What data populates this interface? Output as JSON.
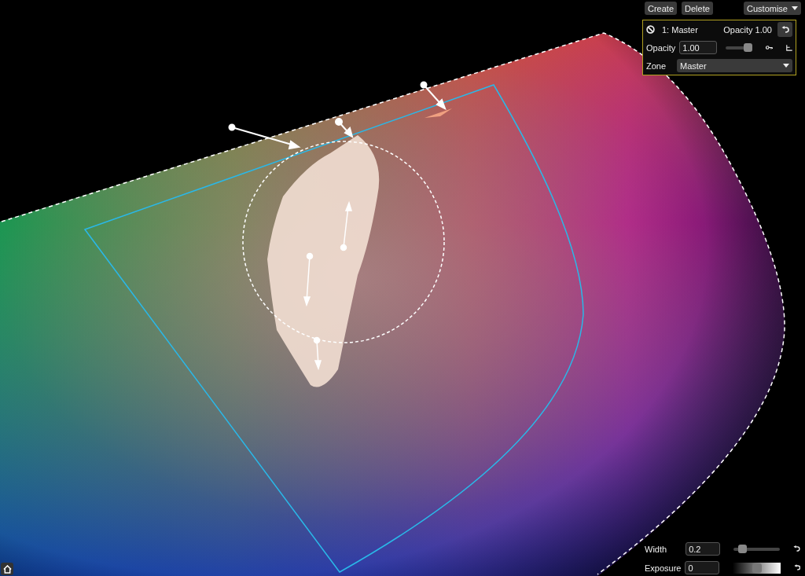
{
  "toolbar": {
    "buttons": [
      {
        "label": "Create"
      },
      {
        "label": "Delete"
      }
    ],
    "menu": {
      "label": "Customise"
    }
  },
  "layer_panel": {
    "title": "1: Master",
    "opacity_summary": "Opacity 1.00",
    "opacity_label": "Opacity",
    "opacity_value": "1.00",
    "opacity_slider": {
      "level": 1.0
    },
    "zone_label": "Zone",
    "zone_value": "Master"
  },
  "view_controls": [
    {
      "kind": "slider",
      "label": "Width",
      "value": "0.2",
      "level": 0.12
    },
    {
      "kind": "gradient",
      "label": "Exposure",
      "value": "0",
      "level": 0.5
    }
  ]
}
